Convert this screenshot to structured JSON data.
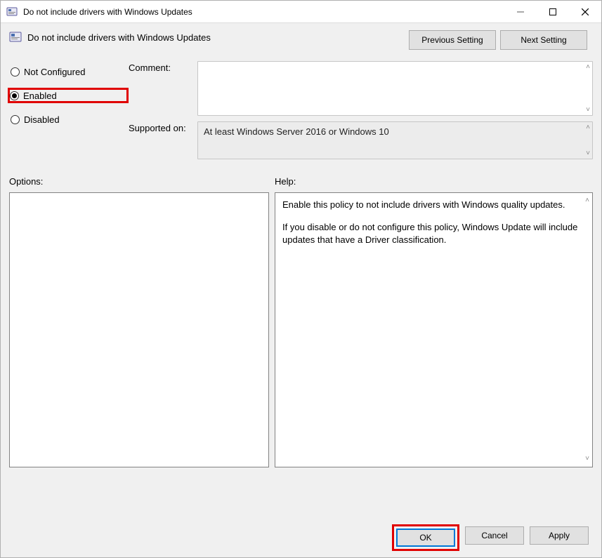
{
  "window": {
    "title": "Do not include drivers with Windows Updates"
  },
  "policy": {
    "title": "Do not include drivers with Windows Updates"
  },
  "nav": {
    "prev": "Previous Setting",
    "next": "Next Setting"
  },
  "radios": {
    "not_configured": "Not Configured",
    "enabled": "Enabled",
    "disabled": "Disabled",
    "selected": "enabled"
  },
  "labels": {
    "comment": "Comment:",
    "supported_on": "Supported on:",
    "options": "Options:",
    "help": "Help:"
  },
  "comment": "",
  "supported_on": "At least Windows Server 2016 or Windows 10",
  "help": {
    "p1": "Enable this policy to not include drivers with Windows quality updates.",
    "p2": "If you disable or do not configure this policy, Windows Update will include updates that have a Driver classification."
  },
  "footer": {
    "ok": "OK",
    "cancel": "Cancel",
    "apply": "Apply"
  }
}
